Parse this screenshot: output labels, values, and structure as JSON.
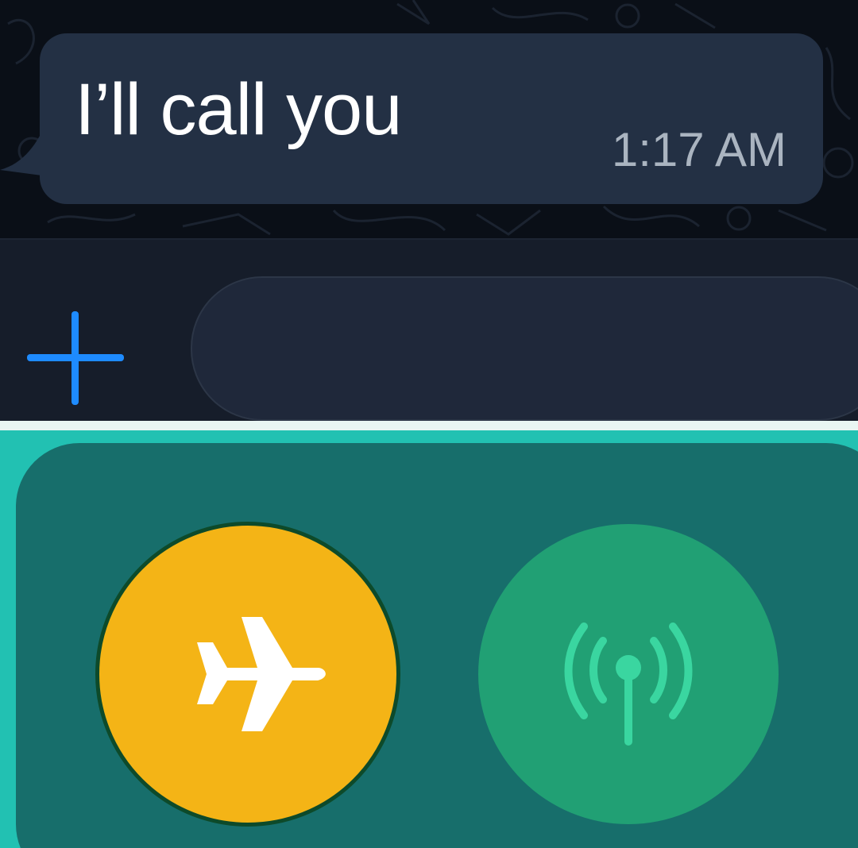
{
  "chat": {
    "message": {
      "text": "I’ll call you",
      "time": "1:17 AM",
      "direction": "incoming"
    }
  },
  "input_bar": {
    "attach_icon": "plus-icon",
    "field_value": "",
    "accent_color": "#1e8bff"
  },
  "control_center": {
    "airplane_mode": {
      "icon": "airplane-icon",
      "enabled": true,
      "color": "#f4b416"
    },
    "cellular_data": {
      "icon": "cellular-antenna-icon",
      "enabled": false,
      "color": "#21a074"
    }
  }
}
